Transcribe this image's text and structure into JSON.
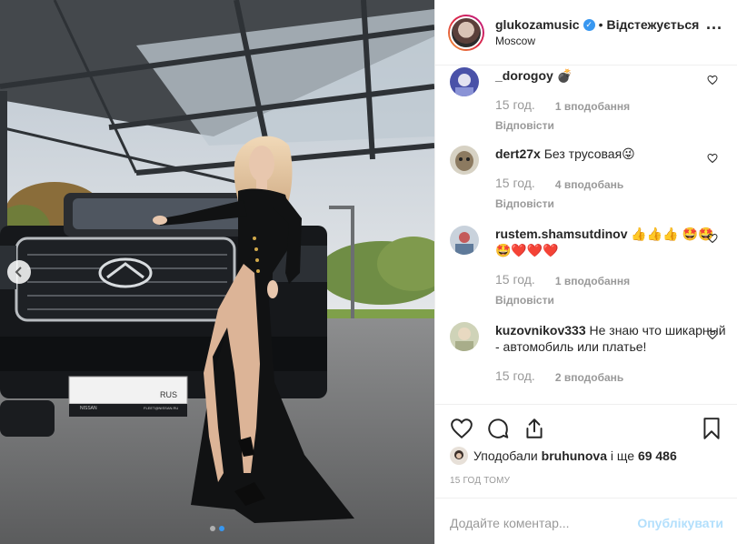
{
  "post": {
    "username": "glukozamusic",
    "follow_state": "Відстежується",
    "location": "Moscow",
    "plate_text": "RUS",
    "dealer_text": "NISSAN",
    "dealer_subtext": "FLEET@NISSAN.RU"
  },
  "comments": [
    {
      "user": "_dorogoy",
      "text": "💣",
      "time": "15 год.",
      "likes": "1 вподобання",
      "reply": "Відповісти"
    },
    {
      "user": "dert27x",
      "text": "Без трусовая😜",
      "time": "15 год.",
      "likes": "4 вподобань",
      "reply": "Відповісти"
    },
    {
      "user": "rustem.shamsutdinov",
      "text": "👍👍👍 🤩🤩🤩❤️❤️❤️",
      "time": "15 год.",
      "likes": "1 вподобання",
      "reply": "Відповісти"
    },
    {
      "user": "kuzovnikov333",
      "text": "Не знаю что шикарный - автомобиль или платье!",
      "time": "15 год.",
      "likes": "2 вподобань",
      "reply": ""
    }
  ],
  "likes_line": {
    "prefix": "Уподобали",
    "user": "bruhunova",
    "middle": "і ще",
    "count": "69 486"
  },
  "post_time": "15 ГОД ТОМУ",
  "add_comment": {
    "placeholder": "Додайте коментар...",
    "publish": "Опублікувати"
  },
  "icons": {
    "like": "heart-icon",
    "comment": "comment-icon",
    "share": "share-icon",
    "save": "bookmark-icon",
    "more": "more-options-icon",
    "prev": "chevron-left-icon"
  },
  "colors": {
    "accent": "#3897f0",
    "publish_disabled": "#b2dffc",
    "muted": "#999999"
  }
}
